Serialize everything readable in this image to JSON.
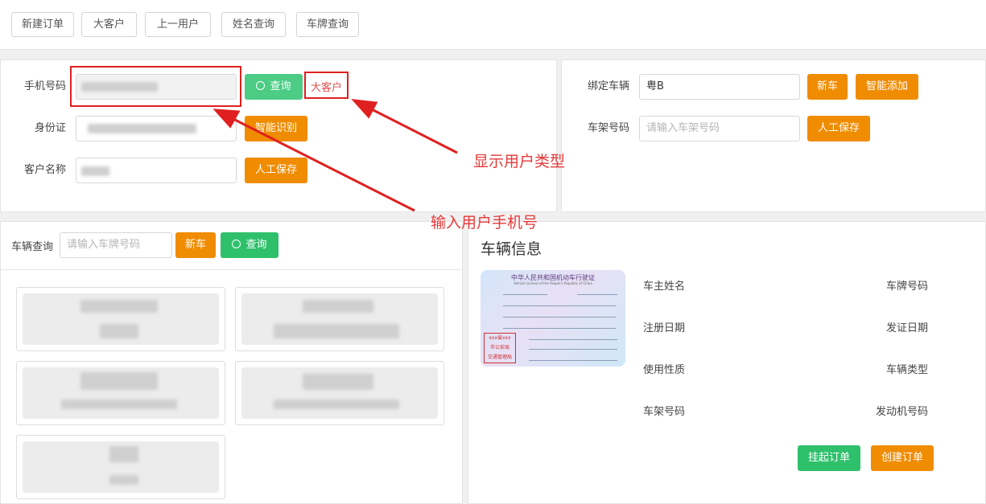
{
  "toolbar": {
    "buttons": [
      "新建订单",
      "大客户",
      "上一用户",
      "姓名查询",
      "车牌查询"
    ]
  },
  "customer": {
    "phone_label": "手机号码",
    "query_button": "查询",
    "customer_type": "大客户",
    "id_label": "身份证",
    "smart_recognize_button": "智能识别",
    "name_label": "客户名称",
    "manual_save_button": "人工保存"
  },
  "vehicle_bind": {
    "bind_label": "绑定车辆",
    "bind_value": "粤B",
    "new_car_button": "新车",
    "smart_add_button": "智能添加",
    "vin_label": "车架号码",
    "vin_placeholder": "请输入车架号码",
    "manual_save_button": "人工保存"
  },
  "vehicle_search": {
    "label": "车辆查询",
    "placeholder": "请输入车牌号码",
    "new_car_button": "新车",
    "query_button": "查询"
  },
  "vehicle_info": {
    "title": "车辆信息",
    "fields_left": [
      "车主姓名",
      "注册日期",
      "使用性质",
      "车架号码"
    ],
    "fields_right": [
      "车牌号码",
      "发证日期",
      "车辆类型",
      "发动机号码"
    ],
    "hold_order_button": "挂起订单",
    "create_order_button": "创建订单"
  },
  "license_image": {
    "title": "中华人民共和国机动车行驶证",
    "subtitle": "Vehicle License of the People's Republic of China",
    "stamp_line1": "xxx省xxx",
    "stamp_line2": "市公安局",
    "stamp_line3": "交通管理局"
  },
  "annotations": {
    "show_user_type": "显示用户类型",
    "input_phone": "输入用户手机号"
  },
  "colors": {
    "orange": "#f08c00",
    "green": "#2fc06c",
    "annotation_red": "#e02020"
  },
  "icons": {
    "search": "search-icon"
  }
}
